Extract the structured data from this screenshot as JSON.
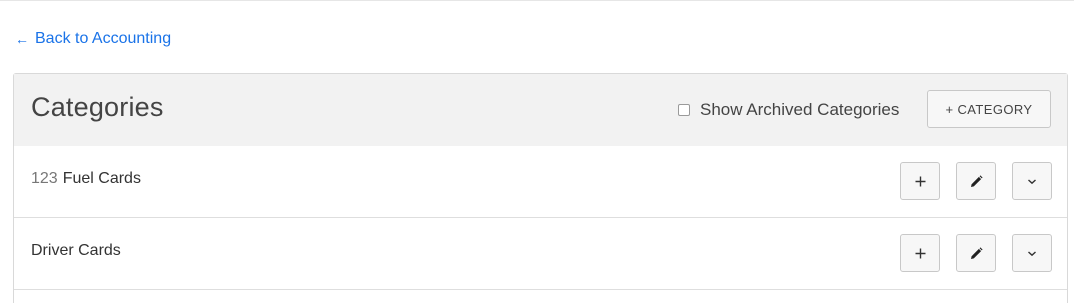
{
  "nav": {
    "back_arrow": "←",
    "back_label": "Back to Accounting",
    "link_color": "#1a73e8"
  },
  "panel": {
    "title": "Categories",
    "show_archived_label": "Show Archived Categories",
    "show_archived_checked": false,
    "add_category_label": "+ CATEGORY"
  },
  "rows": [
    {
      "code": "123",
      "name": "Fuel Cards",
      "actions": [
        "plus-icon",
        "pencil-icon",
        "chevron-down-icon"
      ]
    },
    {
      "code": "",
      "name": "Driver Cards",
      "actions": [
        "plus-icon",
        "pencil-icon",
        "chevron-down-icon"
      ]
    }
  ]
}
